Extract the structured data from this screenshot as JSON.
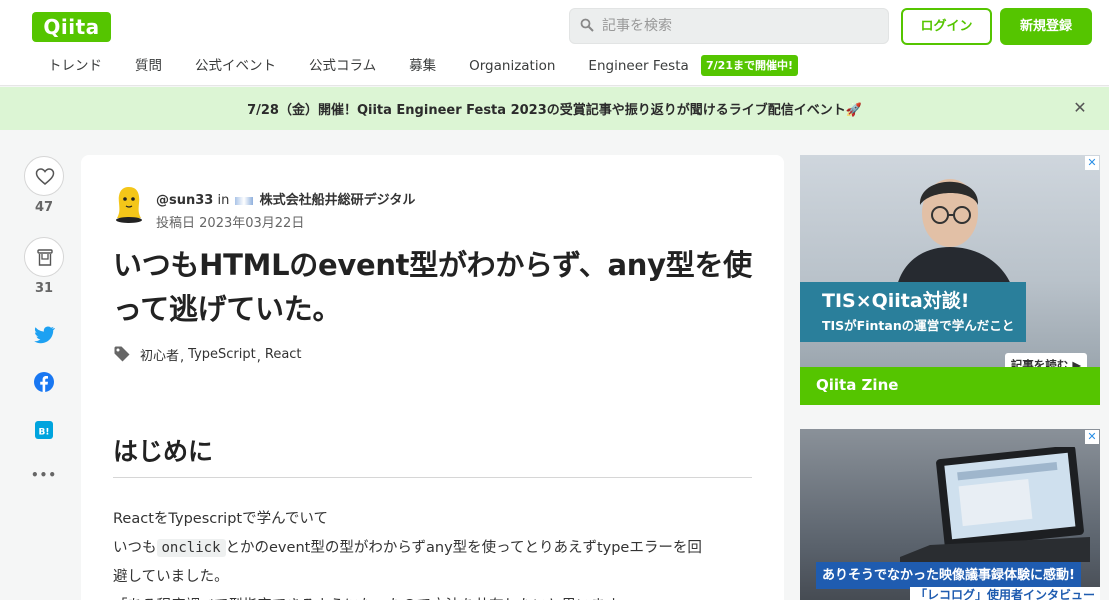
{
  "header": {
    "logo": "Qiita",
    "search_placeholder": "記事を検索",
    "login_label": "ログイン",
    "signup_label": "新規登録"
  },
  "nav": {
    "items": [
      "トレンド",
      "質問",
      "公式イベント",
      "公式コラム",
      "募集",
      "Organization",
      "Engineer Festa"
    ],
    "badge": "7/21まで開催中!"
  },
  "banner": {
    "text": "7/28（金）開催！Qiita Engineer Festa 2023の受賞記事や振り返りが聞けるライブ配信イベント🚀",
    "close": "✕"
  },
  "sidebar": {
    "like_count": "47",
    "stock_count": "31",
    "more": "•••"
  },
  "article": {
    "author": "@sun33",
    "in": "in",
    "organization": "株式会社船井総研デジタル",
    "posted_label": "投稿日",
    "posted_date": "2023年03月22日",
    "title": "いつもHTMLのevent型がわからず、any型を使って逃げていた。",
    "tags": [
      "初心者",
      "TypeScript",
      "React"
    ],
    "heading": "はじめに",
    "p_line1": "ReactをTypescriptで学んでいて",
    "p_line2_pre": "いつも",
    "p_line2_code": "onclick",
    "p_line2_post": "とかのevent型の型がわからずany型を使ってとりあえずtypeエラーを回",
    "p_line3": "避していました。",
    "p_line4": "「ある程度調べて型指定できるようになったので方法を共有したいと思います"
  },
  "ads": {
    "ad1_title": "TIS×Qiita対談!",
    "ad1_sub": "TISがFintanの運営で学んだこと",
    "ad1_cta": "記事を読む ▶",
    "ad1_brand": "Qiita Zine",
    "ad2_caption": "ありそうでなかった映像議事録体験に感動!",
    "ad2_sub": "「レコログ」使用者インタビュー",
    "close": "✕"
  },
  "colors": {
    "brand": "#55c500",
    "banner_bg": "#dcf5d4"
  }
}
